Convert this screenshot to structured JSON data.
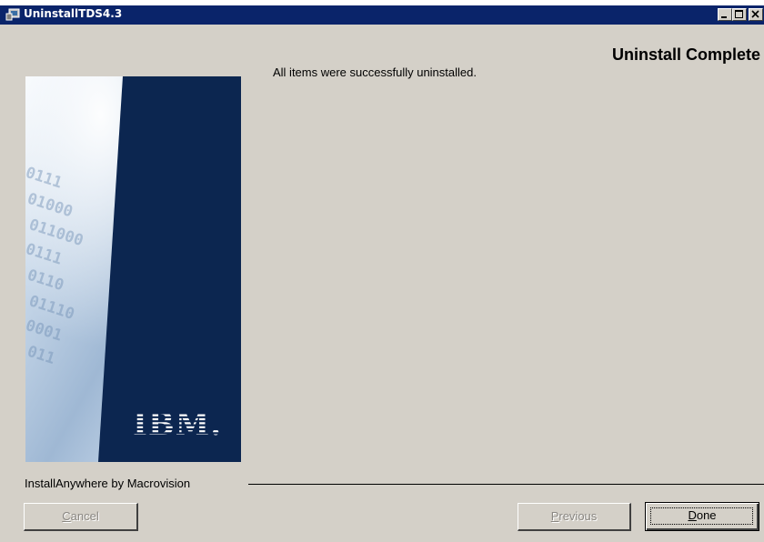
{
  "window": {
    "title": "UninstallTDS4.3",
    "icon": "installer-icon",
    "controls": [
      "minimize-icon",
      "maximize-icon",
      "close-icon"
    ]
  },
  "header": {
    "title": "Uninstall Complete"
  },
  "side_panel": {
    "logo_text": "IBM.",
    "binary_text": [
      "0111",
      "01000",
      "011000",
      "0111",
      "0110",
      "01110",
      "0001",
      "011"
    ]
  },
  "message": "All items were successfully uninstalled.",
  "footer": {
    "vendor": "InstallAnywhere by Macrovision",
    "cancel": {
      "mnemonic": "C",
      "rest": "ancel",
      "enabled": false
    },
    "previous": {
      "mnemonic": "P",
      "rest": "revious",
      "enabled": false
    },
    "done": {
      "mnemonic": "D",
      "rest": "one",
      "enabled": true
    }
  },
  "colors": {
    "titlebar": "#0a246a",
    "dialog_bg": "#d4d0c8",
    "panel_dark": "#0c2650"
  }
}
